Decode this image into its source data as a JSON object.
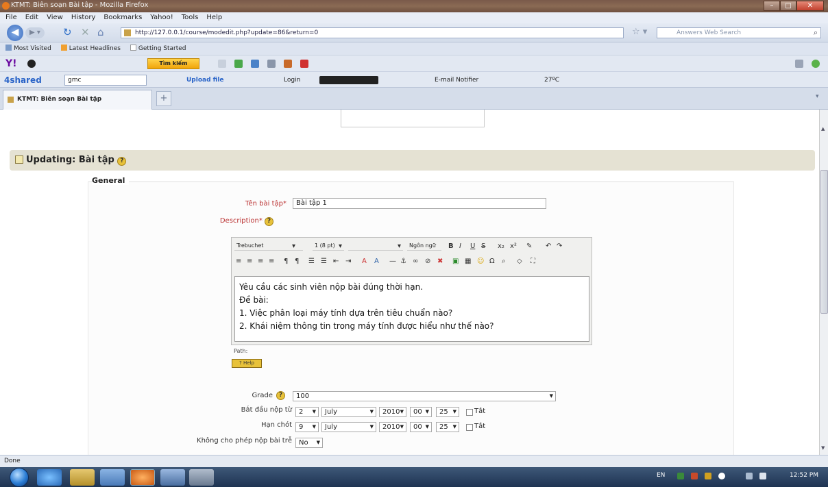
{
  "window": {
    "title": "KTMT: Biên soạn Bài tập - Mozilla Firefox"
  },
  "menu": [
    "File",
    "Edit",
    "View",
    "History",
    "Bookmarks",
    "Yahoo!",
    "Tools",
    "Help"
  ],
  "nav": {
    "url": "http://127.0.0.1/course/modedit.php?update=86&return=0",
    "search_placeholder": "Answers Web Search"
  },
  "bookmarks": [
    "Most Visited",
    "Latest Headlines",
    "Getting Started"
  ],
  "yahoo_toolbar": {
    "logo": "Y!",
    "search_button": "Tìm kiếm"
  },
  "toolbar2": {
    "logo": "4shared",
    "query": "gmc",
    "upload": "Upload file",
    "login": "Login",
    "email": "E-mail Notifier",
    "weather": "27ºC"
  },
  "tab": {
    "label": "KTMT: Biên soạn Bài tập",
    "new_tab": "+"
  },
  "page": {
    "heading": "Updating: Bài tập",
    "section": "General",
    "name_label": "Tên bài tập*",
    "name_value": "Bài tập 1",
    "description_label": "Description*",
    "help_glyph": "?",
    "editor": {
      "font": "Trebuchet",
      "size": "1 (8 pt)",
      "lang": "Ngôn ngữ",
      "content": [
        "Yêu cầu các sinh viên nộp bài đúng thời hạn.",
        "Đề bài:",
        "1. Việc phân loại máy tính dựa trên tiêu chuẩn nào?",
        "2. Khái niệm thông tin trong máy tính được hiểu như thế nào?"
      ],
      "path_label": "Path:",
      "help_button": "? Help"
    },
    "grade_label": "Grade",
    "grade_value": "100",
    "start_label": "Bắt đầu nộp từ",
    "start": {
      "day": "2",
      "month": "July",
      "year": "2010",
      "hour": "00",
      "minute": "25",
      "toggle": "Tắt"
    },
    "due_label": "Hạn chót",
    "due": {
      "day": "9",
      "month": "July",
      "year": "2010",
      "hour": "00",
      "minute": "25",
      "toggle": "Tắt"
    },
    "late_label": "Không cho phép nộp bài trễ",
    "late_value": "No"
  },
  "status": {
    "text": "Done"
  },
  "taskbar": {
    "lang": "EN",
    "clock": "12:52 PM"
  }
}
